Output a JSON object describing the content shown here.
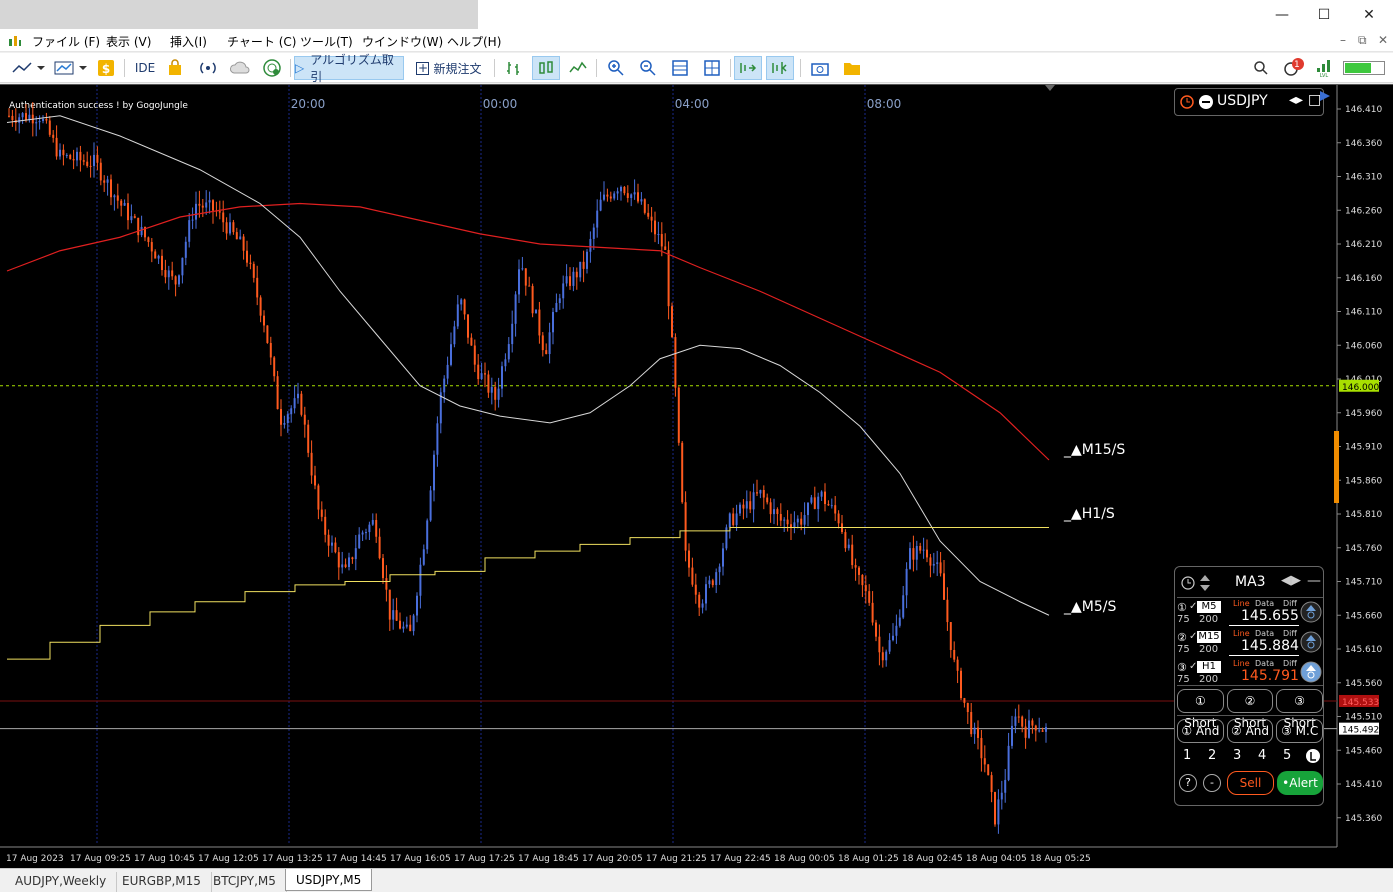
{
  "menu": {
    "items": [
      "ファイル (F)",
      "表示 (V)",
      "挿入(I)",
      "チャート (C)",
      "ツール(T)",
      "ウインドウ(W)",
      "ヘルプ(H)"
    ]
  },
  "toolbar": {
    "ide_label": "IDE",
    "algo_label": "アルゴリズム取引",
    "new_order_label": "新規注文",
    "notif_count": "1"
  },
  "chart": {
    "auth_text": "Authentication success ! by GogoJungle",
    "time_markers": [
      "20:00",
      "00:00",
      "04:00",
      "08:00"
    ],
    "price_labels": [
      "146.410",
      "146.360",
      "146.310",
      "146.260",
      "146.210",
      "146.160",
      "146.110",
      "146.060",
      "146.010",
      "145.960",
      "145.910",
      "145.860",
      "145.810",
      "145.760",
      "145.710",
      "145.660",
      "145.610",
      "145.560",
      "145.510",
      "145.460",
      "145.410",
      "145.360"
    ],
    "time_labels": [
      "17 Aug 2023",
      "17 Aug 09:25",
      "17 Aug 10:45",
      "17 Aug 12:05",
      "17 Aug 13:25",
      "17 Aug 14:45",
      "17 Aug 16:05",
      "17 Aug 17:25",
      "17 Aug 18:45",
      "17 Aug 20:05",
      "17 Aug 21:25",
      "17 Aug 22:45",
      "18 Aug 00:05",
      "18 Aug 01:25",
      "18 Aug 02:45",
      "18 Aug 04:05",
      "18 Aug 05:25"
    ],
    "hline_level": "146.000",
    "ask_price": "145.533",
    "bid_price": "145.492",
    "ma_labels": [
      "_▲M15/S",
      "_▲H1/S",
      "_▲M5/S"
    ],
    "colors": {
      "bull": "#4a6fdc",
      "bear": "#ff5a1f",
      "ma_red": "#e02020",
      "ma_white": "#d8d8d8",
      "ma_yellow": "#f0e060",
      "level_green": "#a8e000"
    }
  },
  "symbol_panel": {
    "symbol": "USDJPY"
  },
  "ma_panel": {
    "title": "MA3",
    "col_line": "Line",
    "col_data": "Data",
    "col_diff": "Diff",
    "rows": [
      {
        "num": "①",
        "tf": "M5",
        "p1": "75",
        "p2": "200",
        "value": "145.655"
      },
      {
        "num": "②",
        "tf": "M15",
        "p1": "75",
        "p2": "200",
        "value": "145.884"
      },
      {
        "num": "③",
        "tf": "H1",
        "p1": "75",
        "p2": "200",
        "value": "145.791"
      }
    ],
    "short_buttons": [
      "① Short",
      "② Short",
      "③ Short"
    ],
    "and_buttons": [
      "① And",
      "② And",
      "③ M.C"
    ],
    "numbers": [
      "1",
      "2",
      "3",
      "4",
      "5"
    ],
    "help": "?",
    "minus": "-",
    "sell": "Sell",
    "alert": "•Alert"
  },
  "tabs": [
    "AUDJPY,Weekly",
    "EURGBP,M15",
    "BTCJPY,M5",
    "USDJPY,M5"
  ]
}
